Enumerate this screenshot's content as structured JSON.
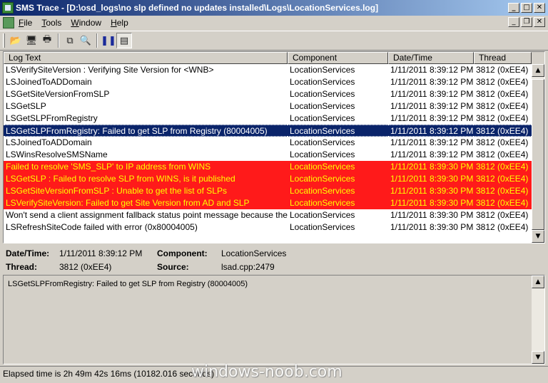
{
  "window": {
    "title": "SMS Trace - [D:\\osd_logs\\no slp  defined no updates installed\\Logs\\LocationServices.log]"
  },
  "menu": {
    "file": {
      "ul": "F",
      "rest": "ile"
    },
    "tools": {
      "ul": "T",
      "rest": "ools"
    },
    "window": {
      "ul": "W",
      "rest": "indow"
    },
    "help": {
      "ul": "H",
      "rest": "elp"
    }
  },
  "toolbar": {
    "icons": [
      "open-icon",
      "print-setup-icon",
      "print-icon",
      "copy-icon",
      "find-icon",
      "pause-icon",
      "details-pane-icon"
    ]
  },
  "columns": {
    "log_text": "Log Text",
    "component": "Component",
    "datetime": "Date/Time",
    "thread": "Thread"
  },
  "rows": [
    {
      "text": "LSVerifySiteVersion : Verifying Site Version for <WNB>",
      "component": "LocationServices",
      "datetime": "1/11/2011 8:39:12 PM",
      "thread": "3812 (0xEE4)",
      "state": "normal"
    },
    {
      "text": "LSJoinedToADDomain",
      "component": "LocationServices",
      "datetime": "1/11/2011 8:39:12 PM",
      "thread": "3812 (0xEE4)",
      "state": "normal"
    },
    {
      "text": "LSGetSiteVersionFromSLP",
      "component": "LocationServices",
      "datetime": "1/11/2011 8:39:12 PM",
      "thread": "3812 (0xEE4)",
      "state": "normal"
    },
    {
      "text": "LSGetSLP",
      "component": "LocationServices",
      "datetime": "1/11/2011 8:39:12 PM",
      "thread": "3812 (0xEE4)",
      "state": "normal"
    },
    {
      "text": "LSGetSLPFromRegistry",
      "component": "LocationServices",
      "datetime": "1/11/2011 8:39:12 PM",
      "thread": "3812 (0xEE4)",
      "state": "normal"
    },
    {
      "text": "LSGetSLPFromRegistry: Failed to get SLP from Registry (80004005)",
      "component": "LocationServices",
      "datetime": "1/11/2011 8:39:12 PM",
      "thread": "3812 (0xEE4)",
      "state": "selected"
    },
    {
      "text": "LSJoinedToADDomain",
      "component": "LocationServices",
      "datetime": "1/11/2011 8:39:12 PM",
      "thread": "3812 (0xEE4)",
      "state": "normal"
    },
    {
      "text": "LSWinsResolveSMSName",
      "component": "LocationServices",
      "datetime": "1/11/2011 8:39:12 PM",
      "thread": "3812 (0xEE4)",
      "state": "normal"
    },
    {
      "text": "Failed to resolve 'SMS_SLP' to IP address from WINS",
      "component": "LocationServices",
      "datetime": "1/11/2011 8:39:30 PM",
      "thread": "3812 (0xEE4)",
      "state": "error"
    },
    {
      "text": "LSGetSLP : Failed to resolve SLP from WINS, is it published",
      "component": "LocationServices",
      "datetime": "1/11/2011 8:39:30 PM",
      "thread": "3812 (0xEE4)",
      "state": "error"
    },
    {
      "text": "LSGetSiteVersionFromSLP : Unable to get the list of SLPs",
      "component": "LocationServices",
      "datetime": "1/11/2011 8:39:30 PM",
      "thread": "3812 (0xEE4)",
      "state": "error"
    },
    {
      "text": "LSVerifySiteVersion: Failed to get Site Version from AD and SLP",
      "component": "LocationServices",
      "datetime": "1/11/2011 8:39:30 PM",
      "thread": "3812 (0xEE4)",
      "state": "error"
    },
    {
      "text": "Won't send a client assignment fallback status point message because the last assi",
      "component": "LocationServices",
      "datetime": "1/11/2011 8:39:30 PM",
      "thread": "3812 (0xEE4)",
      "state": "normal"
    },
    {
      "text": "LSRefreshSiteCode failed with error (0x80004005)",
      "component": "LocationServices",
      "datetime": "1/11/2011 8:39:30 PM",
      "thread": "3812 (0xEE4)",
      "state": "normal"
    }
  ],
  "details": {
    "datetime_label": "Date/Time:",
    "datetime_value": "1/11/2011 8:39:12 PM",
    "component_label": "Component:",
    "component_value": "LocationServices",
    "thread_label": "Thread:",
    "thread_value": "3812 (0xEE4)",
    "source_label": "Source:",
    "source_value": "lsad.cpp:2479"
  },
  "message": "LSGetSLPFromRegistry: Failed to get SLP from Registry (80004005)",
  "status": "Elapsed time is 2h 49m 42s 16ms (10182.016 seconds)",
  "watermark": "windows-noob.com",
  "colors": {
    "title_start": "#0a246a",
    "title_end": "#a6caf0",
    "selected_bg": "#0a246a",
    "error_bg": "#ff1a1a",
    "error_text": "#ffff00",
    "chrome": "#d4d0c8"
  }
}
